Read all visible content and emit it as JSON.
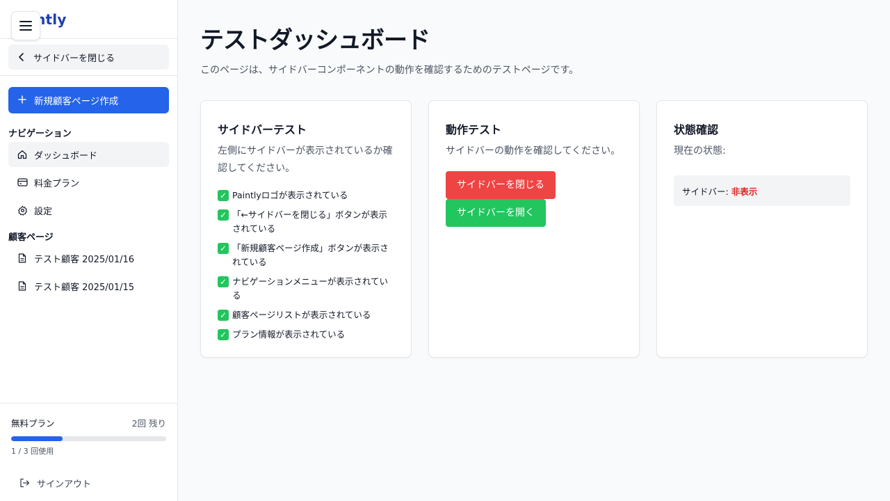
{
  "sidebar": {
    "logo": "Paintly",
    "close_label": "サイドバーを閉じる",
    "new_page_label": "新規顧客ページ作成",
    "nav_title": "ナビゲーション",
    "nav_items": [
      {
        "label": "ダッシュボード",
        "icon": "home-icon"
      },
      {
        "label": "料金プラン",
        "icon": "credit-card-icon"
      },
      {
        "label": "設定",
        "icon": "gear-icon"
      }
    ],
    "customer_title": "顧客ページ",
    "customer_items": [
      {
        "label": "テスト顧客 2025/01/16",
        "icon": "document-icon"
      },
      {
        "label": "テスト顧客 2025/01/15",
        "icon": "document-icon"
      }
    ],
    "plan": {
      "name": "無料プラン",
      "remaining": "2回 残り",
      "usage": "1 / 3 回使用",
      "used_fraction": 0.333
    },
    "signout_label": "サインアウト"
  },
  "main": {
    "title": "テストダッシュボード",
    "description": "このページは、サイドバーコンポーネントの動作を確認するためのテストページです。",
    "cards": {
      "sidebar_test": {
        "title": "サイドバーテスト",
        "description": "左側にサイドバーが表示されているか確認してください。",
        "checklist": [
          "Paintlyロゴが表示されている",
          "「←サイドバーを閉じる」ボタンが表示されている",
          "「新規顧客ページ作成」ボタンが表示されている",
          "ナビゲーションメニューが表示されている",
          "顧客ページリストが表示されている",
          "プラン情報が表示されている"
        ]
      },
      "action_test": {
        "title": "動作テスト",
        "description": "サイドバーの動作を確認してください。",
        "close_button": "サイドバーを閉じる",
        "open_button": "サイドバーを開く"
      },
      "status": {
        "title": "状態確認",
        "current_label": "現在の状態:",
        "sidebar_label": "サイドバー:",
        "sidebar_value": "非表示"
      }
    }
  },
  "colors": {
    "primary": "#2563eb",
    "danger": "#ef4444",
    "success": "#22c55e",
    "status_text": "#dc2626"
  }
}
